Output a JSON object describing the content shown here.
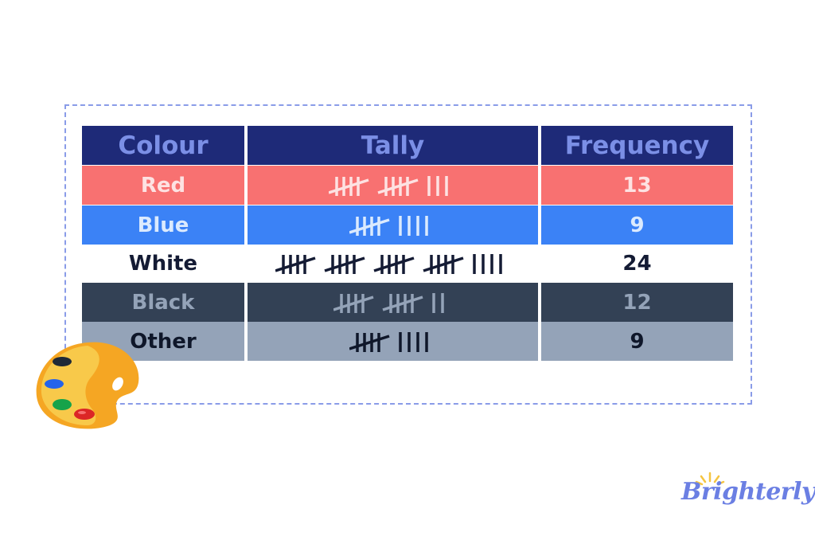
{
  "table": {
    "headers": [
      "Colour",
      "Tally",
      "Frequency"
    ],
    "rows": [
      {
        "colour": "Red",
        "tally": 13,
        "frequency": "13",
        "bg": "#f87171",
        "text": "#fde2e2",
        "mark": "#fde2e2"
      },
      {
        "colour": "Blue",
        "tally": 9,
        "frequency": "9",
        "bg": "#3b82f6",
        "text": "#dbeafe",
        "mark": "#dbeafe"
      },
      {
        "colour": "White",
        "tally": 24,
        "frequency": "24",
        "bg": "#ffffff",
        "text": "#141b34",
        "mark": "#141b34"
      },
      {
        "colour": "Black",
        "tally": 12,
        "frequency": "12",
        "bg": "#334155",
        "text": "#94a3b8",
        "mark": "#94a3b8"
      },
      {
        "colour": "Other",
        "tally": 9,
        "frequency": "9",
        "bg": "#94a3b8",
        "text": "#0f172a",
        "mark": "#0f172a"
      }
    ],
    "header_bg": "#1e2a78",
    "header_text": "#7b8fe6"
  },
  "frame_color": "#8a9ce8",
  "decoration": {
    "icon": "paint-palette-icon"
  },
  "brand": {
    "name": "Brighterly",
    "color": "#6b7fe3",
    "sun_color": "#f5c542"
  }
}
